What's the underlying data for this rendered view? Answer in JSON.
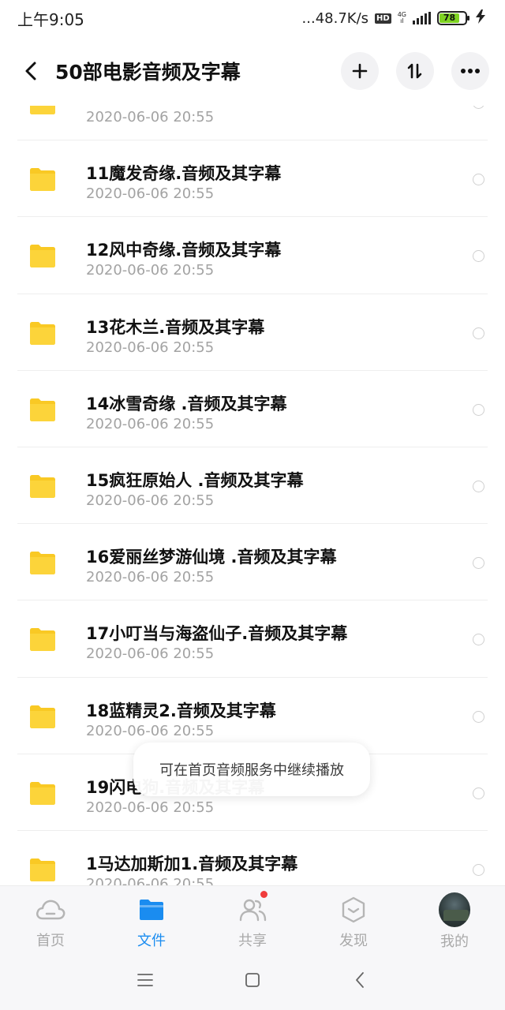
{
  "status_bar": {
    "time": "上午9:05",
    "network_speed": "...48.7K/s",
    "hd_badge": "HD",
    "net_type_top": "4G",
    "net_type_bottom": "ıl",
    "battery": "78",
    "battery_level": 0.78
  },
  "header": {
    "title": "50部电影音频及字幕",
    "add_icon": "plus-icon",
    "sort_icon": "sort-icon",
    "more_icon": "more-icon"
  },
  "files": [
    {
      "name": "",
      "date": "2020-06-06  20:55"
    },
    {
      "name": "11魔发奇缘.音频及其字幕",
      "date": "2020-06-06  20:55"
    },
    {
      "name": "12风中奇缘.音频及其字幕",
      "date": "2020-06-06  20:55"
    },
    {
      "name": "13花木兰.音频及其字幕",
      "date": "2020-06-06  20:55"
    },
    {
      "name": "14冰雪奇缘 .音频及其字幕",
      "date": "2020-06-06  20:55"
    },
    {
      "name": "15疯狂原始人 .音频及其字幕",
      "date": "2020-06-06  20:55"
    },
    {
      "name": "16爱丽丝梦游仙境 .音频及其字幕",
      "date": "2020-06-06  20:55"
    },
    {
      "name": "17小叮当与海盗仙子.音频及其字幕",
      "date": "2020-06-06  20:55"
    },
    {
      "name": "18蓝精灵2.音频及其字幕",
      "date": "2020-06-06  20:55"
    },
    {
      "name": "19闪电狗.音频及其字幕",
      "date": "2020-06-06  20:55"
    },
    {
      "name": "1马达加斯加1.音频及其字幕",
      "date": "2020-06-06  20:55"
    }
  ],
  "toast": {
    "message": "可在首页音频服务中继续播放"
  },
  "tabs": [
    {
      "label": "首页",
      "icon": "cloud-icon"
    },
    {
      "label": "文件",
      "icon": "folder-icon"
    },
    {
      "label": "共享",
      "icon": "people-icon"
    },
    {
      "label": "发现",
      "icon": "discover-icon"
    },
    {
      "label": "我的",
      "icon": "avatar"
    }
  ],
  "colors": {
    "accent": "#1a8cf0",
    "folder": "#f9c924",
    "badge_red": "#f03c3c",
    "inactive_tab": "#a9a9a9"
  }
}
